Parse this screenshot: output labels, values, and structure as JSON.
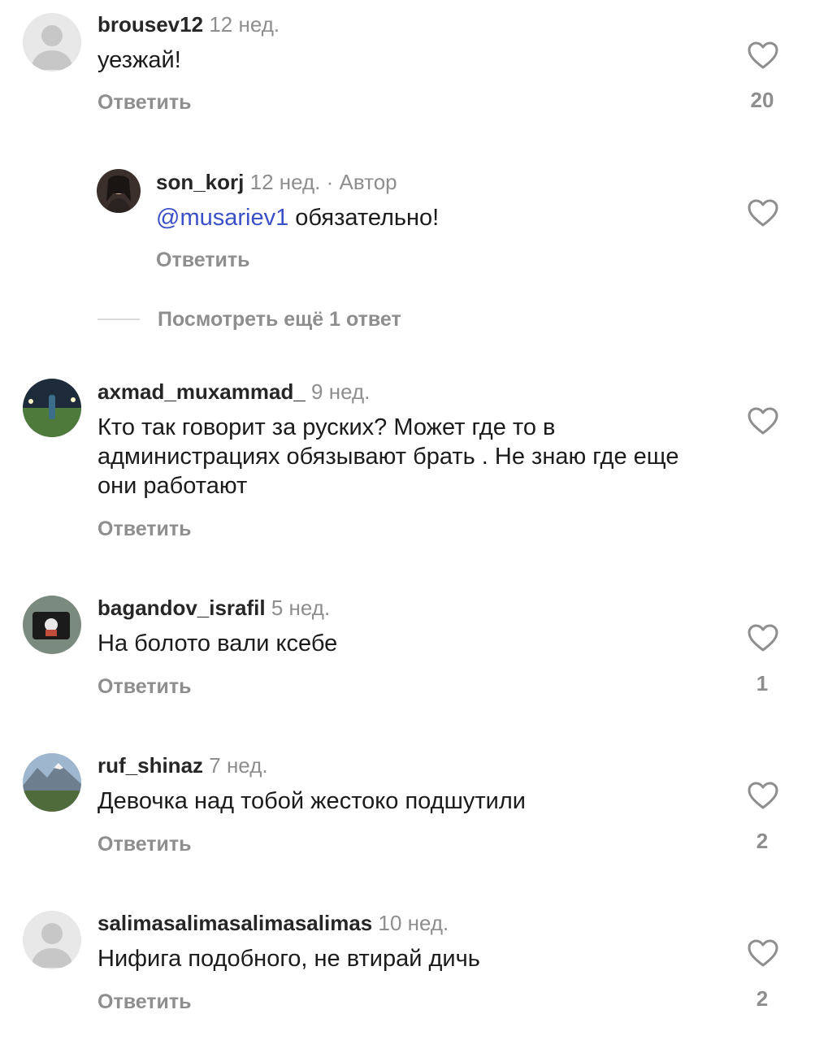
{
  "comments": [
    {
      "username": "brousev12",
      "time": "12 нед.",
      "text": "уезжай!",
      "reply_label": "Ответить",
      "likes": "20",
      "avatar": "default-avatar"
    },
    {
      "username": "son_korj",
      "time": "12 нед.",
      "author_tag": "· Автор",
      "mention": "@musariev1",
      "text": " обязательно!",
      "reply_label": "Ответить",
      "likes": "",
      "avatar": "photo-avatar"
    },
    {
      "username": "axmad_muxammad_",
      "time": "9 нед.",
      "text": "Кто так говорит за руских? Может где то в администрациях обязывают брать . Не знаю где еще они работают",
      "reply_label": "Ответить",
      "likes": "",
      "avatar": "photo-avatar"
    },
    {
      "username": "bagandov_israfil",
      "time": "5 нед.",
      "text": "На болото вали ксебе",
      "reply_label": "Ответить",
      "likes": "1",
      "avatar": "photo-avatar"
    },
    {
      "username": "ruf_shinaz",
      "time": "7 нед.",
      "text": "Девочка над тобой жестоко  подшутили",
      "reply_label": "Ответить",
      "likes": "2",
      "avatar": "photo-avatar"
    },
    {
      "username": "salimasalimasalimasalimas",
      "time": "10 нед.",
      "text": "Нифига подобного, не втирай дичь",
      "reply_label": "Ответить",
      "likes": "2",
      "avatar": "default-avatar"
    }
  ],
  "view_more_replies": "Посмотреть ещё 1 ответ",
  "colors": {
    "mention": "#3b50c8",
    "muted": "#8e8e8e",
    "text": "#1b1b1b"
  }
}
